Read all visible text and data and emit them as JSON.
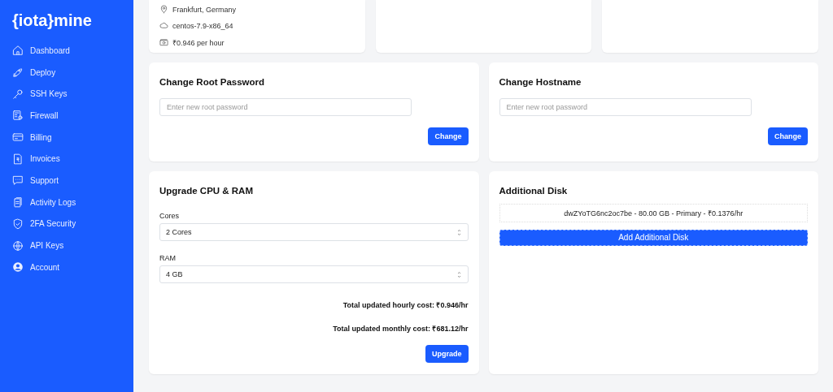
{
  "sidebar": {
    "logo": "{iota}mine",
    "items": [
      "Dashboard",
      "Deploy",
      "SSH Keys",
      "Firewall",
      "Billing",
      "Invoices",
      "Support",
      "Activity Logs",
      "2FA Security",
      "API Keys",
      "Account"
    ]
  },
  "server_info": [
    "Frankfurt, Germany",
    "centos-7.9-x86_64",
    "₹0.946 per hour"
  ],
  "change_root_password": {
    "title": "Change Root Password",
    "placeholder": "Enter new root password",
    "button": "Change"
  },
  "change_hostname": {
    "title": "Change Hostname",
    "placeholder": "Enter new root password",
    "button": "Change"
  },
  "upgrade": {
    "title": "Upgrade CPU & RAM",
    "cores_label": "Cores",
    "cores_value": "2 Cores",
    "ram_label": "RAM",
    "ram_value": "4 GB",
    "hourly": "Total updated hourly cost: ₹0.946/hr",
    "monthly": "Total updated monthly cost: ₹681.12/hr",
    "button": "Upgrade"
  },
  "additional_disk": {
    "title": "Additional Disk",
    "disks": [
      "dwZYoTG6nc2oc7be - 80.00 GB - Primary - ₹0.1376/hr"
    ],
    "button": "Add Additional Disk"
  }
}
